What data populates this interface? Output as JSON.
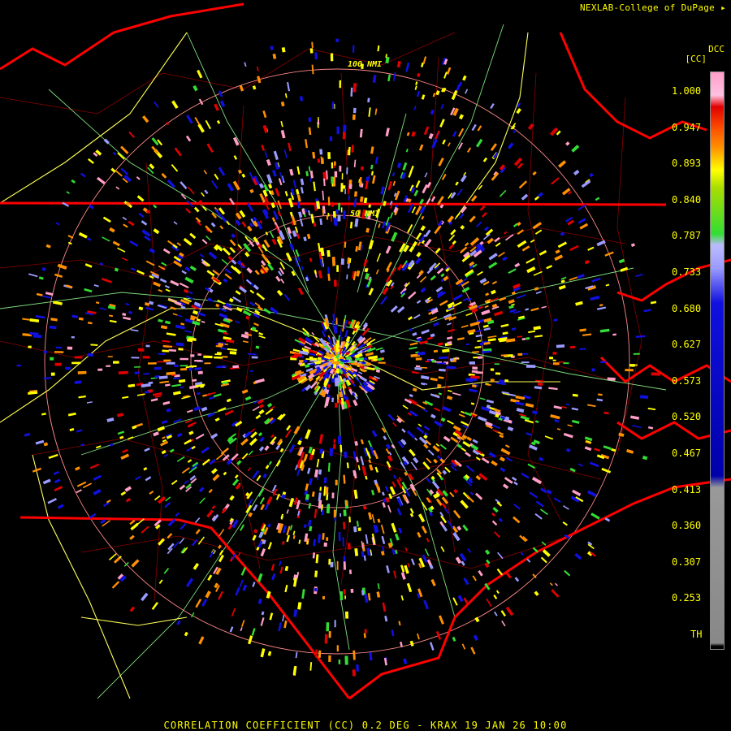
{
  "credit": "NEXLAB-College of DuPage",
  "footer": "CORRELATION COEFFICIENT (CC) 0.2 DEG - KRAX 19 JAN 26 10:00",
  "range_rings": {
    "outer_label": "100 NMI",
    "inner_label": "50 NMI"
  },
  "legend": {
    "product": "DCC",
    "units": "[CC]",
    "ticks": [
      "1.000",
      "0.947",
      "0.893",
      "0.840",
      "0.787",
      "0.733",
      "0.680",
      "0.627",
      "0.573",
      "0.520",
      "0.467",
      "0.413",
      "0.360",
      "0.307",
      "0.253",
      "TH"
    ],
    "colors": {
      "high": "#ff9ec8",
      "red": "#e00000",
      "orange": "#ff9000",
      "yellow": "#ffff00",
      "green": "#33dd33",
      "lavender": "#9a9aff",
      "blue": "#1010e0",
      "gray": "#999999"
    }
  },
  "map_colors": {
    "state_lines": "#ff0000",
    "county_lines": "#a00000",
    "roads_green": "#88ee88",
    "roads_yellow": "#ffff66",
    "rings": "#ff9090"
  }
}
